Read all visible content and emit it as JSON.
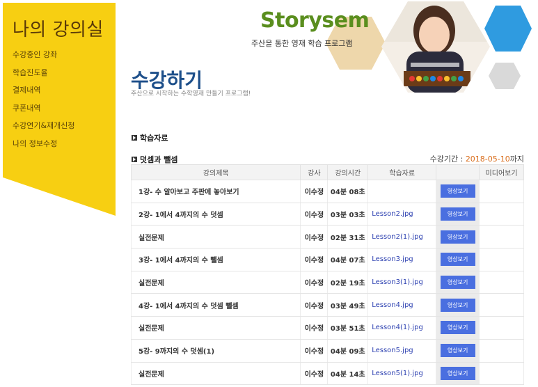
{
  "sidebar": {
    "title": "나의 강의실",
    "items": [
      {
        "label": "수강중인 강좌"
      },
      {
        "label": "학습진도율"
      },
      {
        "label": "결제내역"
      },
      {
        "label": "쿠폰내역"
      },
      {
        "label": "수강연기&재개신청"
      },
      {
        "label": "나의 정보수정"
      }
    ]
  },
  "header": {
    "logo": "Storysem",
    "logo_subtitle": "주산을 통한 영재 학습 프로그램",
    "page_title": "수강하기",
    "page_subtitle": "주산으로 시작하는 수학영재 만들기 프로그램!"
  },
  "sections": {
    "materials_label": "학습자료",
    "course_label": "덧셈과 뺄셈",
    "period_label": "수강기간 : ",
    "period_date": "2018-05-10",
    "period_suffix": "까지"
  },
  "table": {
    "headers": [
      "강의제목",
      "강사",
      "강의시간",
      "학습자료",
      "",
      "미디어보기"
    ],
    "button_label": "영상보기",
    "rows": [
      {
        "title": "1강- 수 알아보고 주판에 놓아보기",
        "tutor": "이수정",
        "time": "04분 08초",
        "file": ""
      },
      {
        "title": "2강- 1에서 4까지의 수 덧셈",
        "tutor": "이수정",
        "time": "03분 03초",
        "file": "Lesson2.jpg"
      },
      {
        "title": "실전문제",
        "tutor": "이수정",
        "time": "02분 31초",
        "file": "Lesson2(1).jpg"
      },
      {
        "title": "3강- 1에서 4까지의 수 뺄셈",
        "tutor": "이수정",
        "time": "04분 07초",
        "file": "Lesson3.jpg"
      },
      {
        "title": "실전문제",
        "tutor": "이수정",
        "time": "02분 19초",
        "file": "Lesson3(1).jpg"
      },
      {
        "title": "4강- 1에서 4까지의 수 덧셈 뺄셈",
        "tutor": "이수정",
        "time": "03분 49초",
        "file": "Lesson4.jpg"
      },
      {
        "title": "실전문제",
        "tutor": "이수정",
        "time": "03분 51초",
        "file": "Lesson4(1).jpg"
      },
      {
        "title": "5강- 9까지의 수 덧셈(1)",
        "tutor": "이수정",
        "time": "04분 09초",
        "file": "Lesson5.jpg"
      },
      {
        "title": "실전문제",
        "tutor": "이수정",
        "time": "04분 14초",
        "file": "Lesson5(1).jpg"
      }
    ]
  },
  "colors": {
    "sidebar_yellow": "#f7cf12",
    "title_blue": "#1d4f8a",
    "logo_green": "#5a8e1e",
    "button_blue": "#4a6fe0",
    "link_blue": "#2b3fb0",
    "date_orange": "#d96c1a"
  }
}
